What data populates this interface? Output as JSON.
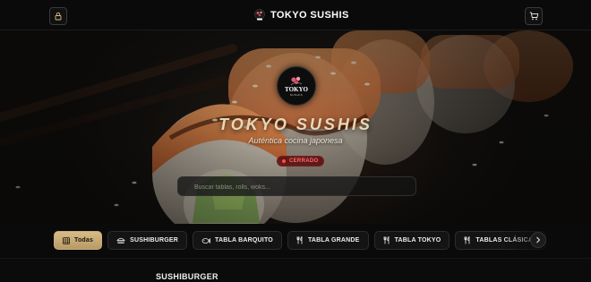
{
  "header": {
    "brand_name": "TOKYO SUSHIS",
    "lock_icon": "lock-icon",
    "cart_icon": "cart-icon"
  },
  "hero": {
    "logo_text": "TOKYO",
    "logo_subtext": "SUSHIS",
    "title": "TOKYO SUSHIS",
    "subtitle": "Auténtica cocina japonesa",
    "status": "CERRADO",
    "status_color": "#ff4d4d"
  },
  "search": {
    "placeholder": "Buscar tablas, rolls, woks...",
    "value": ""
  },
  "categories": [
    {
      "label": "Todas",
      "icon": "grid-icon",
      "active": true
    },
    {
      "label": "SUSHIBURGER",
      "icon": "burger-icon",
      "active": false
    },
    {
      "label": "TABLA BARQUITO",
      "icon": "fish-icon",
      "active": false
    },
    {
      "label": "TABLA GRANDE",
      "icon": "utensils-icon",
      "active": false
    },
    {
      "label": "TABLA TOKYO",
      "icon": "utensils-icon",
      "active": false
    },
    {
      "label": "TABLAS CLÁSICAS",
      "icon": "utensils-icon",
      "active": false
    }
  ],
  "section": {
    "title": "SUSHIBURGER"
  },
  "colors": {
    "accent_gold": "#d8bb86",
    "title_gold": "#e9d7b6",
    "background": "#0b0b0b"
  }
}
